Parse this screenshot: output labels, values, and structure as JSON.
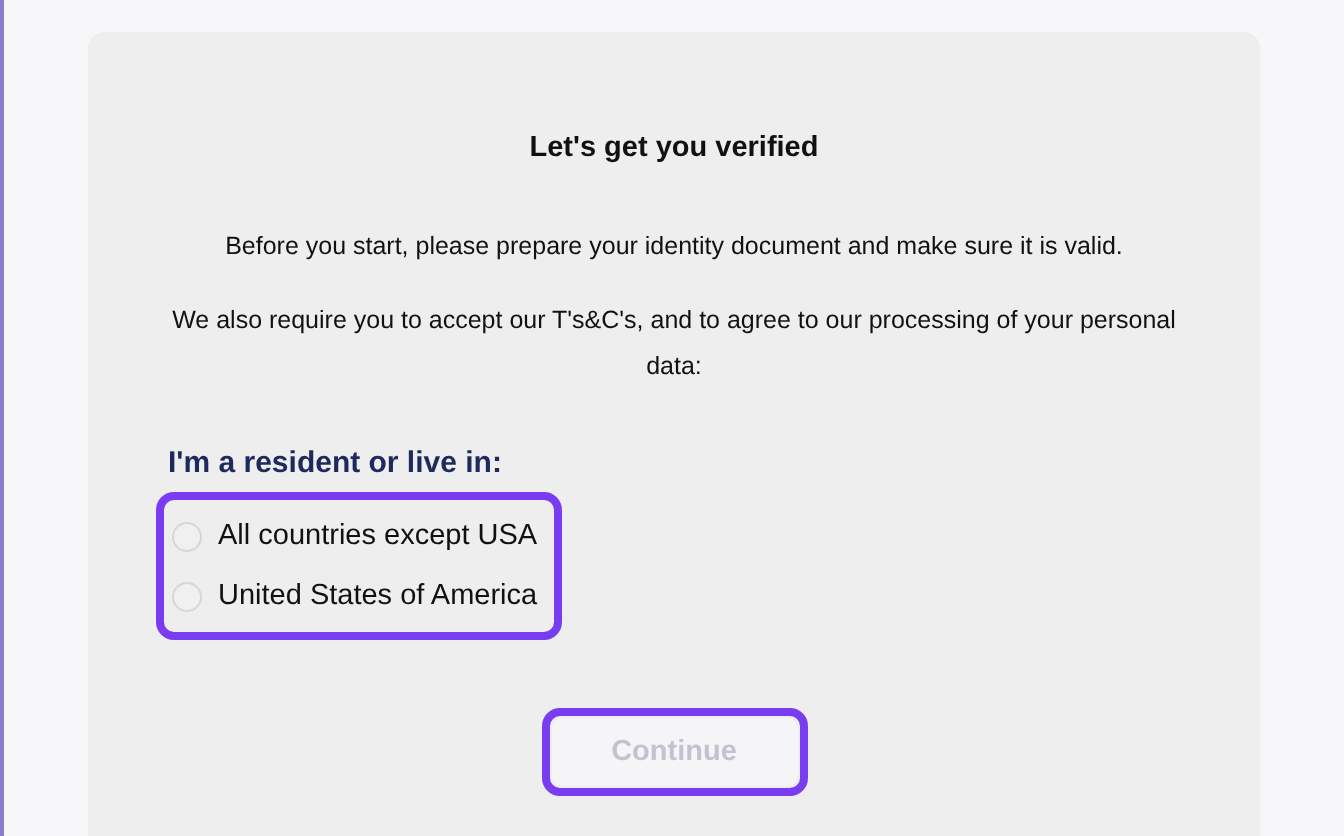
{
  "title": "Let's get you verified",
  "paragraphs": [
    "Before you start, please prepare your identity document and make sure it is valid.",
    "We also require you to accept our T's&C's, and to agree to our processing of your personal data:"
  ],
  "residence": {
    "label": "I'm a resident or live in:",
    "highlighted": true,
    "options": [
      {
        "label": "All countries except USA",
        "selected": false
      },
      {
        "label": "United States of America",
        "selected": false
      }
    ]
  },
  "continue_button": {
    "label": "Continue",
    "disabled": true,
    "highlighted": true
  }
}
